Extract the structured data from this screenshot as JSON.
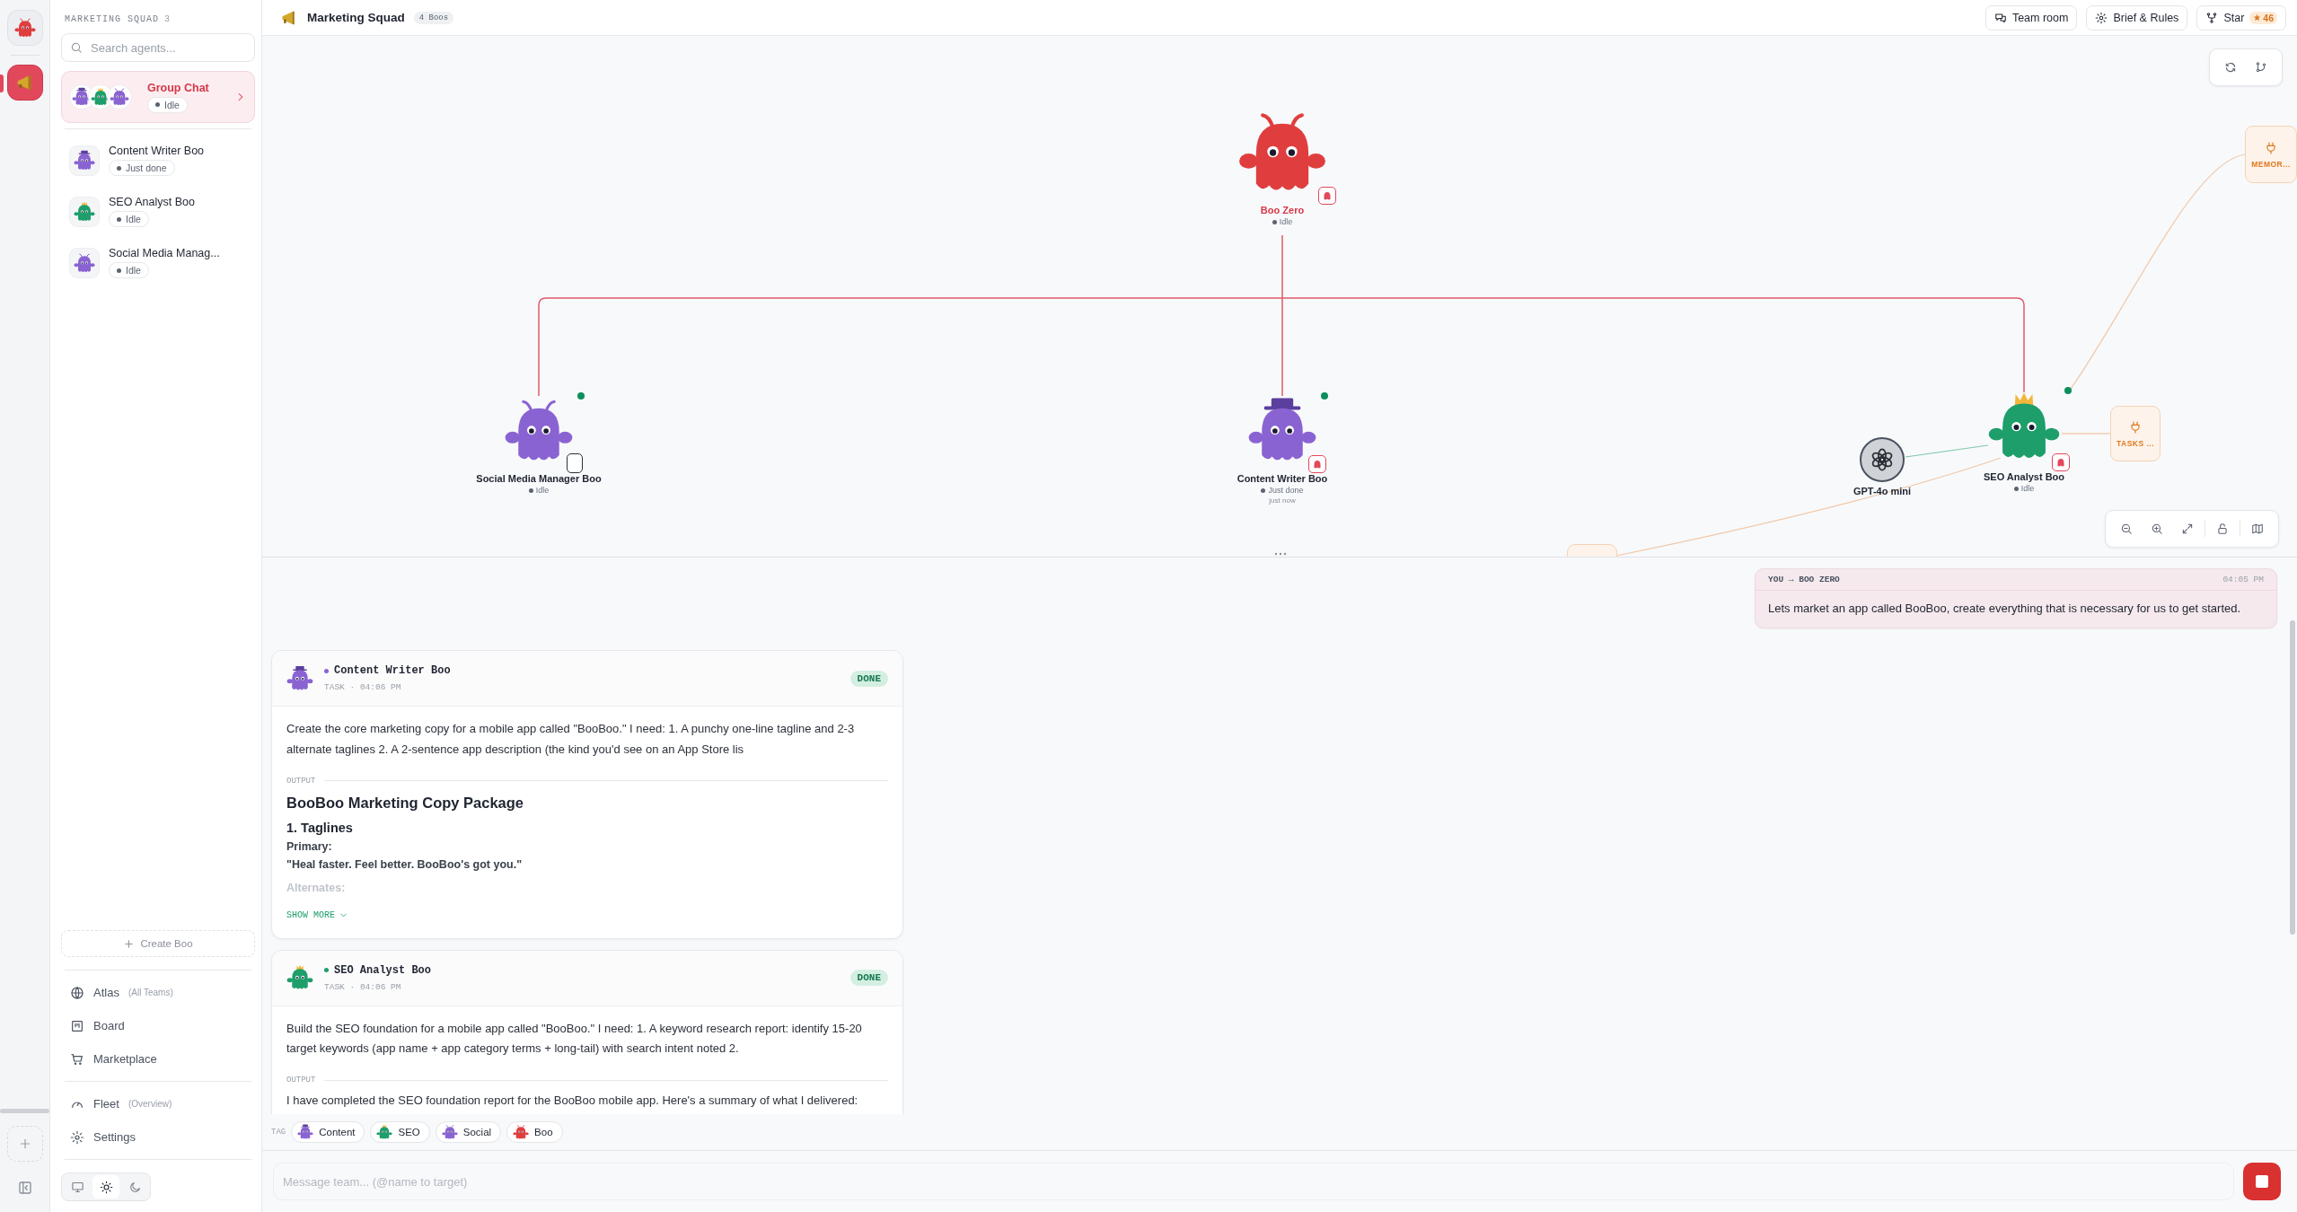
{
  "rail": {
    "items": [
      {
        "kind": "home",
        "selected": false
      },
      {
        "kind": "team",
        "selected": true
      }
    ]
  },
  "sidebar": {
    "title": "MARKETING SQUAD",
    "count": "3",
    "search": {
      "placeholder": "Search agents..."
    },
    "group_chat": {
      "label": "Group Chat",
      "status": "Idle",
      "selected": true,
      "members": [
        {
          "color": "#8a63d2",
          "kind": "hat"
        },
        {
          "color": "#1e9e6a",
          "kind": "crown"
        },
        {
          "color": "#8a63d2",
          "kind": "antennae"
        }
      ]
    },
    "agents": [
      {
        "name": "Content Writer Boo",
        "status": "Just done",
        "color": "#8a63d2",
        "kind": "hat",
        "selected": false
      },
      {
        "name": "SEO Analyst Boo",
        "status": "Idle",
        "color": "#1e9e6a",
        "kind": "crown",
        "selected": false
      },
      {
        "name": "Social Media Manag...",
        "status": "Idle",
        "color": "#8a63d2",
        "kind": "antennae",
        "selected": false
      }
    ],
    "create_button": "Create Boo",
    "nav_groups": [
      [
        {
          "label": "Atlas",
          "note": "(All Teams)"
        },
        {
          "label": "Board"
        },
        {
          "label": "Marketplace"
        }
      ],
      [
        {
          "label": "Fleet",
          "note": "(Overview)"
        },
        {
          "label": "Settings"
        }
      ]
    ],
    "theme": [
      {
        "kind": "system",
        "selected": false
      },
      {
        "kind": "light",
        "selected": true
      },
      {
        "kind": "dark",
        "selected": false
      }
    ]
  },
  "header": {
    "title": "Marketing Squad",
    "badge": "4 Boos",
    "buttons": [
      {
        "label": "Team room"
      },
      {
        "label": "Brief & Rules"
      },
      {
        "label": "Star",
        "count": "46"
      }
    ]
  },
  "canvas": {
    "nodes": [
      {
        "name": "Boo Zero",
        "status": "Idle",
        "color": "#e03e3e",
        "kind": "antennae",
        "lead": true,
        "online": false
      },
      {
        "name": "Social Media Manager Boo",
        "status": "Idle",
        "color": "#8a63d2",
        "kind": "antennae",
        "lead": false,
        "online": true
      },
      {
        "name": "Content Writer Boo",
        "status": "Just done",
        "sublabel": "just now",
        "color": "#8a63d2",
        "kind": "hat",
        "lead": false,
        "online": true
      },
      {
        "name": "SEO Analyst Boo",
        "status": "Idle",
        "color": "#1e9e6a",
        "kind": "crown",
        "lead": false,
        "online": true
      }
    ],
    "model": {
      "name": "GPT-4o mini"
    },
    "tools": [
      {
        "label": "TASKS ..."
      },
      {
        "label": "MEMOR..."
      }
    ]
  },
  "chat": {
    "messages": [
      {
        "header": "YOU → BOO ZERO",
        "time": "04:05 PM",
        "text": "Lets market an app called BooBoo, create everything that is necessary for us to get started."
      }
    ],
    "tasks": [
      {
        "agent": "Content Writer Boo",
        "color": "#8a63d2",
        "kind": "hat",
        "meta": "TASK · 04:06 PM",
        "status": "DONE",
        "prompt": "Create the core marketing copy for a mobile app called \"BooBoo.\" I need: 1. A punchy one-line tagline and 2-3 alternate taglines 2. A 2-sentence app description (the kind you'd see on an App Store lis",
        "output_label": "OUTPUT",
        "output": [
          {
            "kind": "h1",
            "text": "BooBoo Marketing Copy Package"
          },
          {
            "kind": "h2",
            "text": "1. Taglines"
          },
          {
            "kind": "label",
            "text": "Primary:"
          },
          {
            "kind": "quote",
            "text": "\"Heal faster. Feel better. BooBoo's got you.\""
          },
          {
            "kind": "faded",
            "text": "Alternates:"
          }
        ],
        "show_more": "SHOW MORE"
      },
      {
        "agent": "SEO Analyst Boo",
        "color": "#1e9e6a",
        "kind": "crown",
        "meta": "TASK · 04:06 PM",
        "status": "DONE",
        "prompt": "Build the SEO foundation for a mobile app called \"BooBoo.\" I need: 1. A keyword research report: identify 15-20 target keywords (app name + app category terms + long-tail) with search intent noted 2.",
        "output_label": "OUTPUT",
        "output": [
          {
            "kind": "text",
            "text": "I have completed the SEO foundation report for the BooBoo mobile app. Here's a summary of what I delivered:"
          }
        ]
      }
    ]
  },
  "tags": {
    "label": "TAG",
    "items": [
      {
        "label": "Content",
        "color": "#8a63d2",
        "kind": "hat"
      },
      {
        "label": "SEO",
        "color": "#1e9e6a",
        "kind": "crown"
      },
      {
        "label": "Social",
        "color": "#8a63d2",
        "kind": "antennae"
      },
      {
        "label": "Boo",
        "color": "#e03e3e",
        "kind": "antennae"
      }
    ]
  },
  "composer": {
    "placeholder": "Message team... (@name to target)"
  }
}
